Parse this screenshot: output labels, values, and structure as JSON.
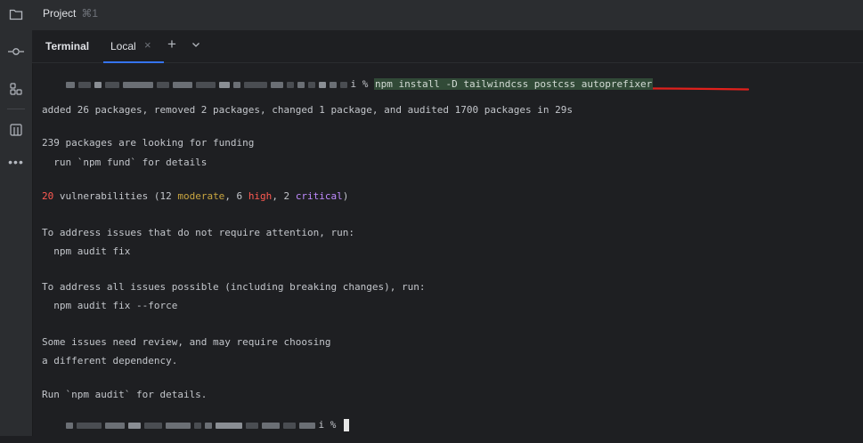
{
  "window": {
    "project_tab": "Project",
    "project_shortcut": "⌘1"
  },
  "tabs": {
    "title": "Terminal",
    "local": "Local",
    "close_glyph": "×",
    "add_glyph": "+"
  },
  "terminal": {
    "prompt_symbol": "i %",
    "command": "npm install -D tailwindcss postcss autoprefixer",
    "added_line": "added 26 packages, removed 2 packages, changed 1 package, and audited 1700 packages in 29s",
    "funding_line": "239 packages are looking for funding",
    "fund_hint": "  run `npm fund` for details",
    "vuln": {
      "count": "20",
      "text1": " vulnerabilities (12 ",
      "moderate": "moderate",
      "text2": ", 6 ",
      "high": "high",
      "text3": ", 2 ",
      "critical": "critical",
      "text4": ")"
    },
    "address_line": "To address issues that do not require attention, run:",
    "audit_fix": "  npm audit fix",
    "address_all_line": "To address all issues possible (including breaking changes), run:",
    "audit_fix_force": "  npm audit fix --force",
    "review_line1": "Some issues need review, and may require choosing",
    "review_line2": "a different dependency.",
    "run_audit": "Run `npm audit` for details.",
    "prompt_symbol_2": "i %"
  },
  "colors": {
    "background": "#1e1f22",
    "sidebar": "#2b2d30",
    "command_highlight": "#314a37",
    "annotation_red": "#e0201c",
    "vuln_count": "#ff5a52",
    "moderate": "#c9a640",
    "high": "#ff5a52",
    "critical": "#c08bff",
    "tab_underline": "#3574f0"
  },
  "icons": [
    "folder-icon",
    "commit-icon",
    "structure-icon",
    "bookmark-icon",
    "more-icon",
    "close-icon",
    "plus-icon",
    "chevron-down-icon"
  ]
}
